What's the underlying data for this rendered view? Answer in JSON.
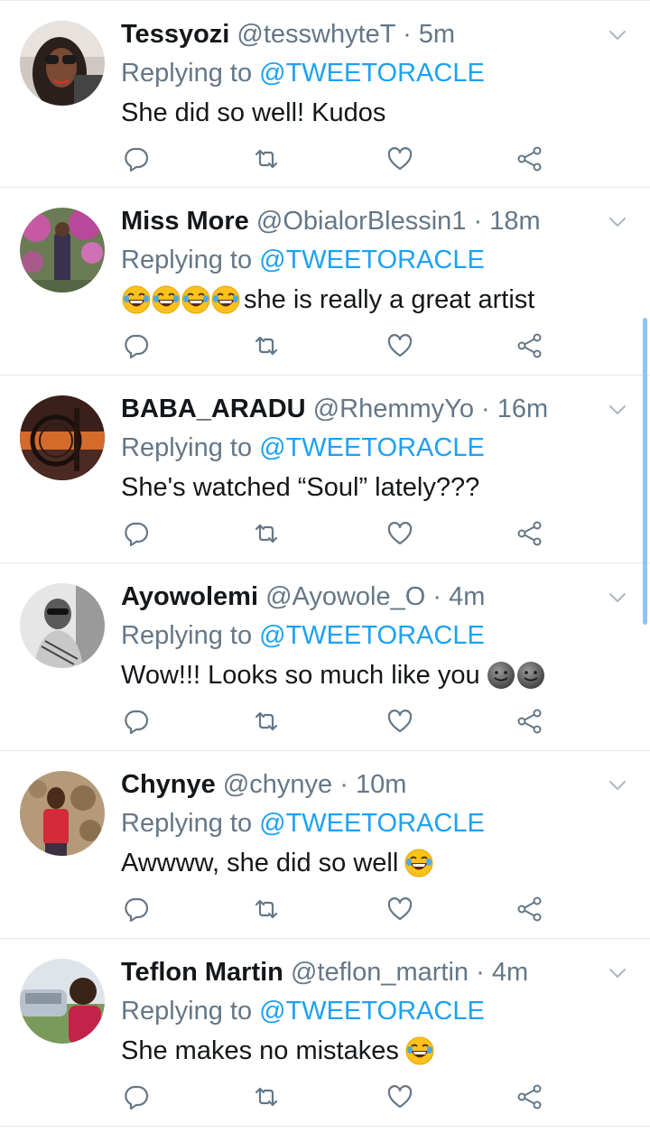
{
  "colors": {
    "accent": "#1da1f2",
    "secondary_text": "#657786",
    "primary_text": "#14171a",
    "divider": "#e1e8ed"
  },
  "replies": [
    {
      "name": "Tessyozi",
      "handle": "@tesswhyteT",
      "dot": "·",
      "time": "5m",
      "reply_prefix": "Replying to",
      "mention": "@TWEETORACLE",
      "text": "She did so well! Kudos",
      "emoji_before": [],
      "emoji_after": []
    },
    {
      "name": "Miss More",
      "handle": "@ObialorBlessin1",
      "dot": "·",
      "time": "18m",
      "reply_prefix": "Replying to",
      "mention": "@TWEETORACLE",
      "text": "she is really a great artist",
      "emoji_before": [
        "laugh-cry-emoji",
        "laugh-cry-emoji",
        "laugh-cry-emoji",
        "laugh-cry-emoji"
      ],
      "emoji_after": []
    },
    {
      "name": "BABA_ARADU",
      "handle": "@RhemmyYo",
      "dot": "·",
      "time": "16m",
      "reply_prefix": "Replying to",
      "mention": "@TWEETORACLE",
      "text": "She's watched “Soul” lately???",
      "emoji_before": [],
      "emoji_after": []
    },
    {
      "name": "Ayowolemi",
      "handle": "@Ayowole_O",
      "dot": "·",
      "time": "4m",
      "reply_prefix": "Replying to",
      "mention": "@TWEETORACLE",
      "text": "Wow!!! Looks so much like you",
      "emoji_before": [],
      "emoji_after": [
        "grey-smile-emoji",
        "grey-smile-emoji"
      ]
    },
    {
      "name": "Chynye",
      "handle": "@chynye",
      "dot": "·",
      "time": "10m",
      "reply_prefix": "Replying to",
      "mention": "@TWEETORACLE",
      "text": "Awwww, she did so well",
      "emoji_before": [],
      "emoji_after": [
        "laugh-cry-emoji"
      ]
    },
    {
      "name": "Teflon Martin",
      "handle": "@teflon_martin",
      "dot": "·",
      "time": "4m",
      "reply_prefix": "Replying to",
      "mention": "@TWEETORACLE",
      "text": "She makes no mistakes",
      "emoji_before": [],
      "emoji_after": [
        "laugh-cry-emoji"
      ]
    }
  ],
  "icons": {
    "reply": "reply-icon",
    "retweet": "retweet-icon",
    "like": "heart-icon",
    "share": "share-icon",
    "more": "chevron-down-icon"
  }
}
